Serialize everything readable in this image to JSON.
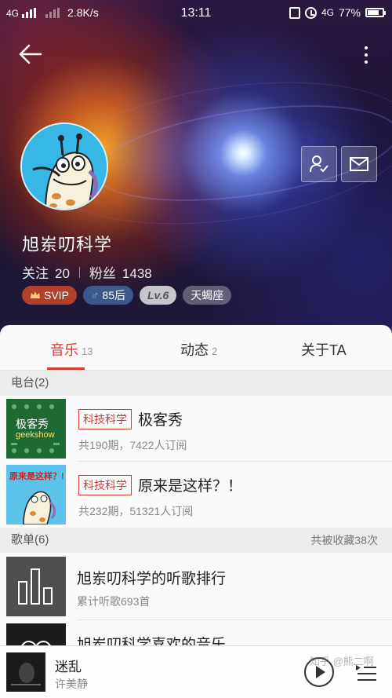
{
  "status_bar": {
    "network_left": "4G",
    "speed": "2.8K/s",
    "time": "13:11",
    "network_right": "4G",
    "battery": "77%"
  },
  "profile": {
    "name": "旭岽叨科学",
    "following_label": "关注",
    "following_count": "20",
    "fans_label": "粉丝",
    "fans_count": "1438",
    "badges": {
      "svip": "SVIP",
      "age": "85后",
      "level": "Lv.6",
      "zodiac": "天蝎座"
    }
  },
  "tabs": [
    {
      "label": "音乐",
      "count": "13"
    },
    {
      "label": "动态",
      "count": "2"
    },
    {
      "label": "关于TA",
      "count": ""
    }
  ],
  "radio_section": {
    "title": "电台(2)",
    "items": [
      {
        "tag": "科技科学",
        "title": "极客秀",
        "meta": "共190期，7422人订阅",
        "thumb_text_1": "极客秀",
        "thumb_text_2": "geekshow"
      },
      {
        "tag": "科技科学",
        "title": "原来是这样？！",
        "meta": "共232期，51321人订阅",
        "thumb_text_1": "原来是这样？!"
      }
    ]
  },
  "playlist_section": {
    "title": "歌单(6)",
    "right_text": "共被收藏38次",
    "items": [
      {
        "title": "旭岽叨科学的听歌排行",
        "meta": "累计听歌693首"
      },
      {
        "title": "旭岽叨科学喜欢的音乐",
        "meta": ""
      }
    ]
  },
  "player": {
    "song": "迷乱",
    "artist": "许美静"
  },
  "watermark": "知乎 @熊二啊",
  "colors": {
    "accent": "#d33a31",
    "section_bg": "#ececec"
  }
}
